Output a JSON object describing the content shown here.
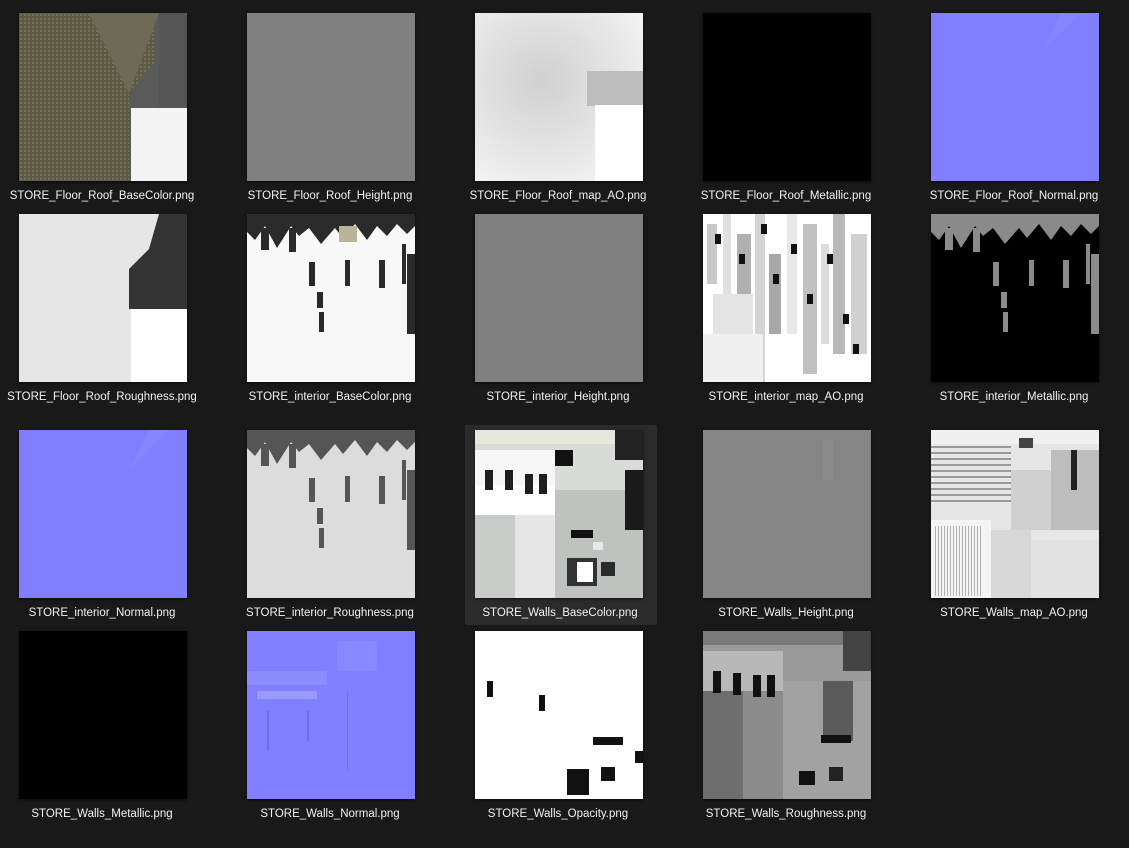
{
  "files": [
    {
      "name": "STORE_Floor_Roof_BaseColor.png",
      "thumb": "floor-basecolor"
    },
    {
      "name": "STORE_Floor_Roof_Height.png",
      "thumb": "flat-gray"
    },
    {
      "name": "STORE_Floor_Roof_map_AO.png",
      "thumb": "floor-ao"
    },
    {
      "name": "STORE_Floor_Roof_Metallic.png",
      "thumb": "flat-black"
    },
    {
      "name": "STORE_Floor_Roof_Normal.png",
      "thumb": "normal"
    },
    {
      "name": "STORE_Floor_Roof_Roughness.png",
      "thumb": "floor-roughness"
    },
    {
      "name": "STORE_interior_BaseColor.png",
      "thumb": "interior-basecolor"
    },
    {
      "name": "STORE_interior_Height.png",
      "thumb": "flat-gray"
    },
    {
      "name": "STORE_interior_map_AO.png",
      "thumb": "interior-ao"
    },
    {
      "name": "STORE_interior_Metallic.png",
      "thumb": "interior-metallic"
    },
    {
      "name": "STORE_interior_Normal.png",
      "thumb": "normal"
    },
    {
      "name": "STORE_interior_Roughness.png",
      "thumb": "interior-roughness"
    },
    {
      "name": "STORE_Walls_BaseColor.png",
      "thumb": "walls-basecolor",
      "selected": true
    },
    {
      "name": "STORE_Walls_Height.png",
      "thumb": "flat-gray-light"
    },
    {
      "name": "STORE_Walls_map_AO.png",
      "thumb": "walls-ao"
    },
    {
      "name": "STORE_Walls_Metallic.png",
      "thumb": "flat-black"
    },
    {
      "name": "STORE_Walls_Normal.png",
      "thumb": "walls-normal"
    },
    {
      "name": "STORE_Walls_Opacity.png",
      "thumb": "walls-opacity"
    },
    {
      "name": "STORE_Walls_Roughness.png",
      "thumb": "walls-roughness"
    }
  ],
  "colors": {
    "background": "#191919",
    "selected": "#2b2b2b",
    "normal_blue": "#7f7fff",
    "label": "#f2f2f2"
  }
}
